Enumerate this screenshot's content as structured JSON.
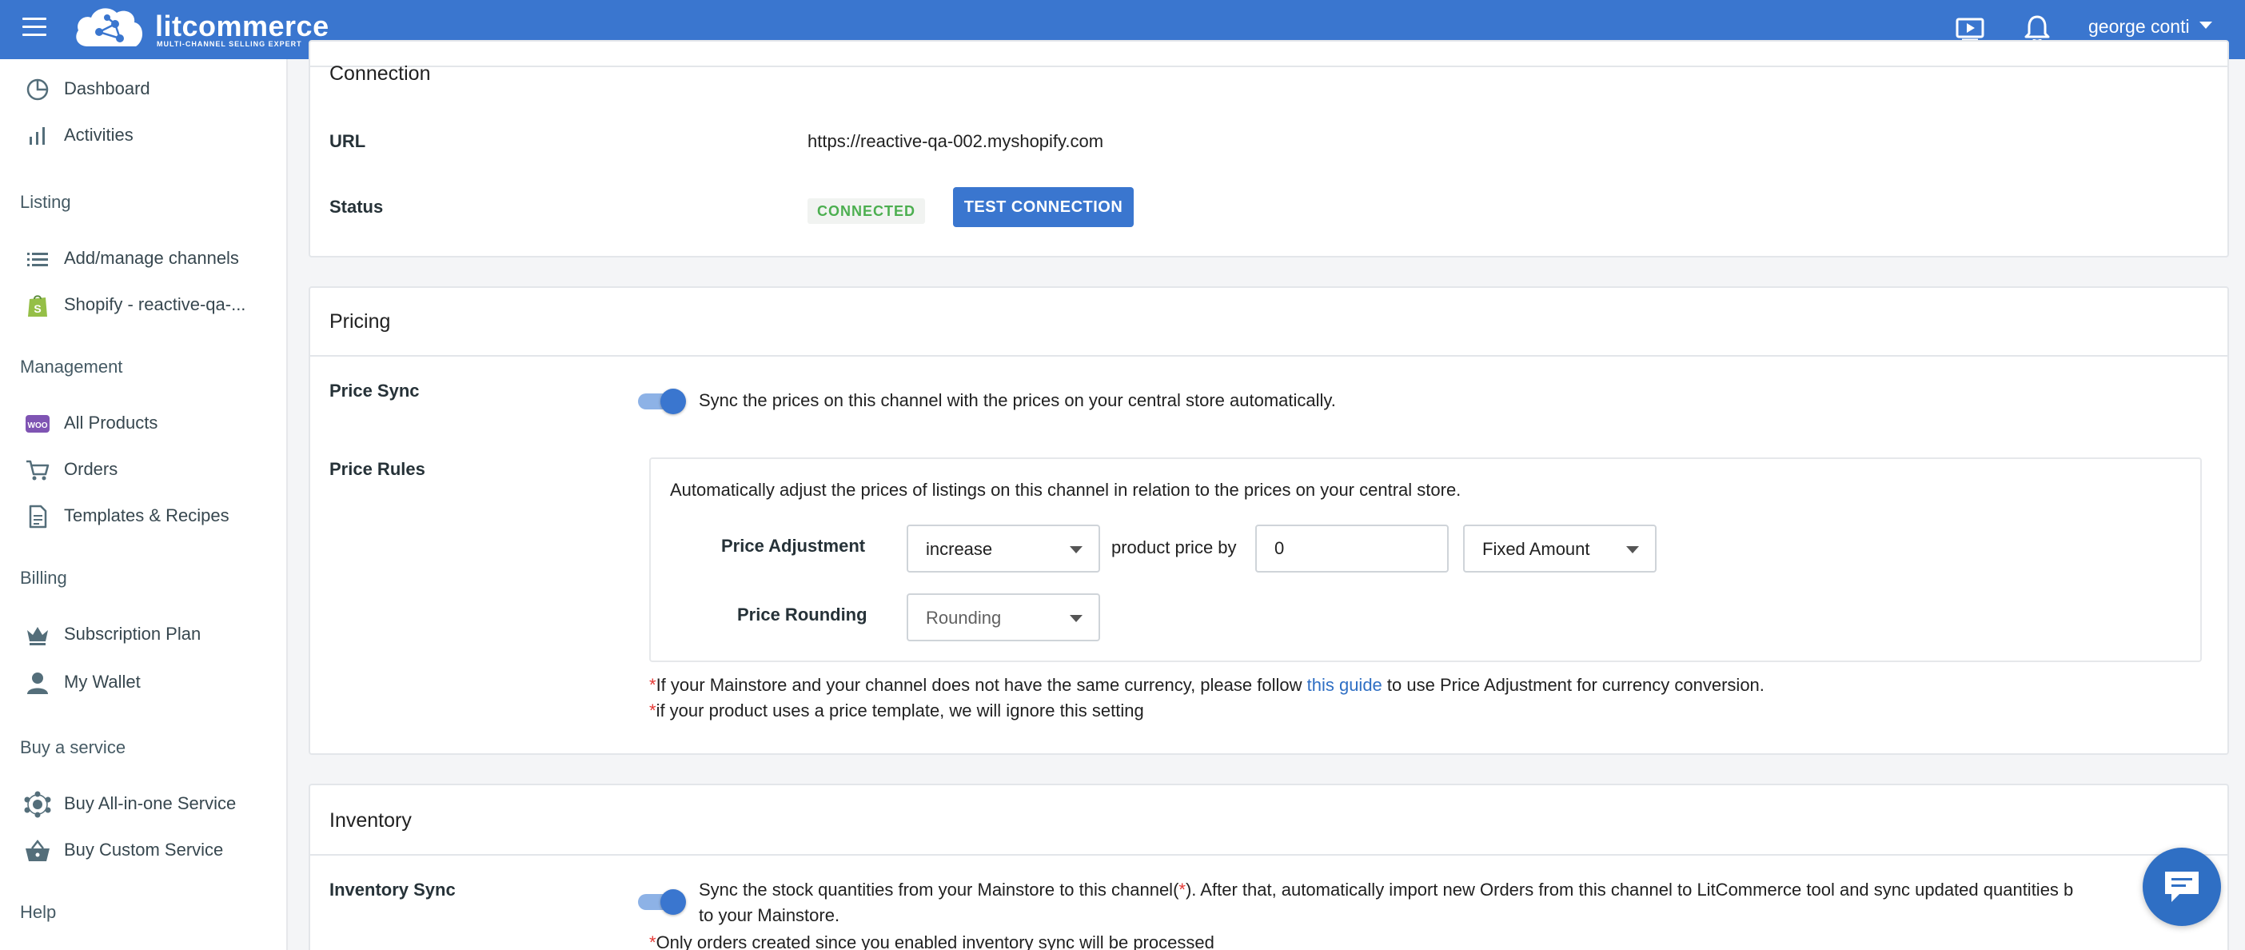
{
  "header": {
    "brand": "litcommerce",
    "tagline": "MULTI-CHANNEL SELLING EXPERT",
    "user_name": "george conti"
  },
  "sidebar": {
    "items_top": [
      {
        "label": "Dashboard",
        "icon": "pie-chart-icon"
      },
      {
        "label": "Activities",
        "icon": "bar-chart-icon"
      }
    ],
    "section_listing": "Listing",
    "items_listing": [
      {
        "label": "Add/manage channels",
        "icon": "list-icon"
      },
      {
        "label": "Shopify - reactive-qa-...",
        "icon": "shopify-icon"
      }
    ],
    "section_management": "Management",
    "items_management": [
      {
        "label": "All Products",
        "icon": "woo-icon"
      },
      {
        "label": "Orders",
        "icon": "cart-icon"
      },
      {
        "label": "Templates & Recipes",
        "icon": "document-icon"
      }
    ],
    "section_billing": "Billing",
    "items_billing": [
      {
        "label": "Subscription Plan",
        "icon": "crown-icon"
      },
      {
        "label": "My Wallet",
        "icon": "person-icon"
      }
    ],
    "section_service": "Buy a service",
    "items_service": [
      {
        "label": "Buy All-in-one Service",
        "icon": "network-icon"
      },
      {
        "label": "Buy Custom Service",
        "icon": "basket-icon"
      }
    ],
    "section_help": "Help"
  },
  "connection": {
    "title": "Connection",
    "url_label": "URL",
    "url_value": "https://reactive-qa-002.myshopify.com",
    "status_label": "Status",
    "status_badge": "CONNECTED",
    "test_button": "TEST CONNECTION"
  },
  "pricing": {
    "title": "Pricing",
    "price_sync_label": "Price Sync",
    "price_sync_enabled": true,
    "price_sync_text": "Sync the prices on this channel with the prices on your central store automatically.",
    "price_rules_label": "Price Rules",
    "rules_description": "Automatically adjust the prices of listings on this channel in relation to the prices on your central store.",
    "adjustment_label": "Price Adjustment",
    "adjustment_direction": "increase",
    "product_price_by": "product price by",
    "adjustment_value": "0",
    "adjustment_type": "Fixed Amount",
    "rounding_label": "Price Rounding",
    "rounding_value": "Rounding",
    "note1_before": "If your Mainstore and your channel does not have the same currency, please follow ",
    "note1_link": "this guide",
    "note1_after": " to use Price Adjustment for currency conversion.",
    "note2": "if your product uses a price template, we will ignore this setting",
    "asterisk": "*"
  },
  "inventory": {
    "title": "Inventory",
    "sync_label": "Inventory Sync",
    "sync_enabled": true,
    "sync_text_1a": "Sync the stock quantities from your Mainstore to this channel(",
    "sync_text_1b": "). After that, automatically import new Orders from this channel to LitCommerce tool and sync updated quantities b",
    "sync_text_2": "to your Mainstore.",
    "note": "Only orders created since you enabled inventory sync will be processed",
    "asterisk": "*"
  },
  "colors": {
    "primary": "#3a76cf",
    "connected": "#4caf50",
    "required": "#e53935"
  }
}
